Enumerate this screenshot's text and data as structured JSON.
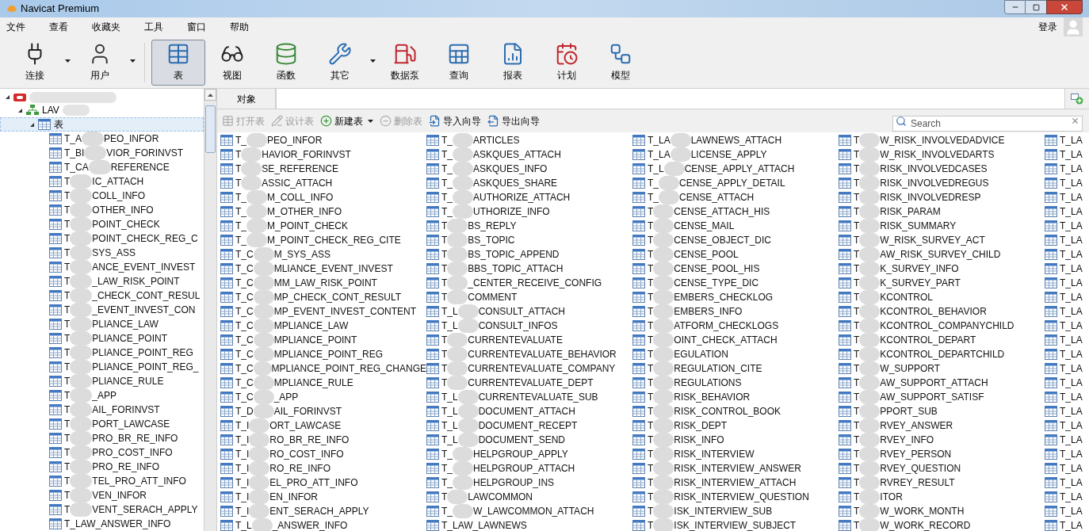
{
  "window": {
    "title": "Navicat Premium"
  },
  "menu": [
    "文件",
    "查看",
    "收藏夹",
    "工具",
    "窗口",
    "帮助"
  ],
  "login": "登录",
  "toolbar": [
    {
      "label": "连接",
      "selected": false,
      "dropdown": true
    },
    {
      "label": "用户",
      "selected": false,
      "dropdown": true
    },
    {
      "label": "表",
      "selected": true,
      "dropdown": false
    },
    {
      "label": "视图",
      "selected": false,
      "dropdown": false
    },
    {
      "label": "函数",
      "selected": false,
      "dropdown": false
    },
    {
      "label": "其它",
      "selected": false,
      "dropdown": true
    },
    {
      "label": "数据泵",
      "selected": false,
      "dropdown": false
    },
    {
      "label": "查询",
      "selected": false,
      "dropdown": false
    },
    {
      "label": "报表",
      "selected": false,
      "dropdown": false
    },
    {
      "label": "计划",
      "selected": false,
      "dropdown": false
    },
    {
      "label": "模型",
      "selected": false,
      "dropdown": false
    }
  ],
  "tree": {
    "connection": {
      "expanded": true
    },
    "database": {
      "label": "LAV",
      "expanded": true
    },
    "tables_node": {
      "label": "表",
      "expanded": true,
      "selected": true
    },
    "items": [
      [
        "T_A",
        "PEO_INFOR"
      ],
      [
        "T_BI",
        "VIOR_FORINVST"
      ],
      [
        "T_CA",
        "REFERENCE"
      ],
      [
        "T",
        "IC_ATTACH"
      ],
      [
        "T",
        "COLL_INFO"
      ],
      [
        "T",
        "OTHER_INFO"
      ],
      [
        "T",
        "POINT_CHECK"
      ],
      [
        "T",
        "POINT_CHECK_REG_C"
      ],
      [
        "T",
        "SYS_ASS"
      ],
      [
        "T",
        "ANCE_EVENT_INVEST"
      ],
      [
        "T",
        "_LAW_RISK_POINT"
      ],
      [
        "T",
        "_CHECK_CONT_RESUL"
      ],
      [
        "T",
        "_EVENT_INVEST_CON"
      ],
      [
        "T",
        "PLIANCE_LAW"
      ],
      [
        "T",
        "PLIANCE_POINT"
      ],
      [
        "T",
        "PLIANCE_POINT_REG"
      ],
      [
        "T",
        "PLIANCE_POINT_REG_"
      ],
      [
        "T",
        "PLIANCE_RULE"
      ],
      [
        "T",
        "_APP"
      ],
      [
        "T",
        "AIL_FORINVST"
      ],
      [
        "T",
        "PORT_LAWCASE"
      ],
      [
        "T",
        "PRO_BR_RE_INFO"
      ],
      [
        "T",
        "PRO_COST_INFO"
      ],
      [
        "T",
        "PRO_RE_INFO"
      ],
      [
        "T",
        "TEL_PRO_ATT_INFO"
      ],
      [
        "T",
        "VEN_INFOR"
      ],
      [
        "T",
        "VENT_SERACH_APPLY"
      ],
      [
        "T_LAW_ANSWER_INFO"
      ]
    ]
  },
  "object_tab": {
    "label": "对象",
    "selected": true
  },
  "actions": [
    {
      "label": "打开表",
      "disabled": true,
      "dropdown": false
    },
    {
      "label": "设计表",
      "disabled": true,
      "dropdown": false
    },
    {
      "label": "新建表",
      "disabled": false,
      "dropdown": true
    },
    {
      "label": "删除表",
      "disabled": true,
      "dropdown": false
    },
    {
      "label": "导入向导",
      "disabled": false,
      "dropdown": false
    },
    {
      "label": "导出向导",
      "disabled": false,
      "dropdown": false
    }
  ],
  "search": {
    "placeholder": "Search"
  },
  "columns": [
    [
      [
        "T_",
        "PEO_INFOR"
      ],
      [
        "T",
        "HAVIOR_FORINVST"
      ],
      [
        "T",
        "SE_REFERENCE"
      ],
      [
        "T",
        "ASSIC_ATTACH"
      ],
      [
        "T_",
        "M_COLL_INFO"
      ],
      [
        "T_",
        "M_OTHER_INFO"
      ],
      [
        "T_",
        "M_POINT_CHECK"
      ],
      [
        "T_",
        "M_POINT_CHECK_REG_CITE"
      ],
      [
        "T_C",
        "M_SYS_ASS"
      ],
      [
        "T_C",
        "MLIANCE_EVENT_INVEST"
      ],
      [
        "T_C",
        "MM_LAW_RISK_POINT"
      ],
      [
        "T_C",
        "MP_CHECK_CONT_RESULT"
      ],
      [
        "T_C",
        "MP_EVENT_INVEST_CONTENT"
      ],
      [
        "T_C",
        "MPLIANCE_LAW"
      ],
      [
        "T_C",
        "MPLIANCE_POINT"
      ],
      [
        "T_C",
        "MPLIANCE_POINT_REG"
      ],
      [
        "T_C",
        "MPLIANCE_POINT_REG_CHANGE"
      ],
      [
        "T_C",
        "MPLIANCE_RULE"
      ],
      [
        "T_C",
        "_APP"
      ],
      [
        "T_D",
        "AIL_FORINVST"
      ],
      [
        "T_I",
        "ORT_LAWCASE"
      ],
      [
        "T_I",
        "RO_BR_RE_INFO"
      ],
      [
        "T_I",
        "RO_COST_INFO"
      ],
      [
        "T_I",
        "RO_RE_INFO"
      ],
      [
        "T_I",
        "EL_PRO_ATT_INFO"
      ],
      [
        "T_I",
        "EN_INFOR"
      ],
      [
        "T_I",
        "ENT_SERACH_APPLY"
      ],
      [
        "T_L",
        "_ANSWER_INFO"
      ]
    ],
    [
      [
        "T_",
        "ARTICLES"
      ],
      [
        "T_",
        "ASKQUES_ATTACH"
      ],
      [
        "T_",
        "ASKQUES_INFO"
      ],
      [
        "T_",
        "ASKQUES_SHARE"
      ],
      [
        "T_",
        "AUTHORIZE_ATTACH"
      ],
      [
        "T_",
        "UTHORIZE_INFO"
      ],
      [
        "T",
        "BS_REPLY"
      ],
      [
        "T",
        "BS_TOPIC"
      ],
      [
        "T",
        "BS_TOPIC_APPEND"
      ],
      [
        "T",
        "BBS_TOPIC_ATTACH"
      ],
      [
        "T",
        "_CENTER_RECEIVE_CONFIG"
      ],
      [
        "T",
        "COMMENT"
      ],
      [
        "T_L",
        "CONSULT_ATTACH"
      ],
      [
        "T_L",
        "CONSULT_INFOS"
      ],
      [
        "T",
        "CURRENTEVALUATE"
      ],
      [
        "T",
        "CURRENTEVALUATE_BEHAVIOR"
      ],
      [
        "T",
        "CURRENTEVALUATE_COMPANY"
      ],
      [
        "T",
        "CURRENTEVALUATE_DEPT"
      ],
      [
        "T_L",
        "CURRENTEVALUATE_SUB"
      ],
      [
        "T_L",
        "DOCUMENT_ATTACH"
      ],
      [
        "T_L",
        "DOCUMENT_RECEPT"
      ],
      [
        "T_L",
        "DOCUMENT_SEND"
      ],
      [
        "T_",
        "HELPGROUP_APPLY"
      ],
      [
        "T_",
        "HELPGROUP_ATTACH"
      ],
      [
        "T_",
        "HELPGROUP_INS"
      ],
      [
        "T",
        "LAWCOMMON"
      ],
      [
        "T_",
        "W_LAWCOMMON_ATTACH"
      ],
      [
        "T_LAW_LAWNEWS"
      ]
    ],
    [
      [
        "T_LA",
        "LAWNEWS_ATTACH"
      ],
      [
        "T_LA",
        "LICENSE_APPLY"
      ],
      [
        "T_L",
        "CENSE_APPLY_ATTACH"
      ],
      [
        "T_",
        "CENSE_APPLY_DETAIL"
      ],
      [
        "T_",
        "CENSE_ATTACH"
      ],
      [
        "T",
        "CENSE_ATTACH_HIS"
      ],
      [
        "T",
        "CENSE_MAIL"
      ],
      [
        "T",
        "CENSE_OBJECT_DIC"
      ],
      [
        "T",
        "CENSE_POOL"
      ],
      [
        "T",
        "CENSE_POOL_HIS"
      ],
      [
        "T",
        "CENSE_TYPE_DIC"
      ],
      [
        "T",
        "EMBERS_CHECKLOG"
      ],
      [
        "T",
        "EMBERS_INFO"
      ],
      [
        "T",
        "ATFORM_CHECKLOGS"
      ],
      [
        "T",
        "OINT_CHECK_ATTACH"
      ],
      [
        "T",
        "EGULATION"
      ],
      [
        "T",
        "REGULATION_CITE"
      ],
      [
        "T",
        "REGULATIONS"
      ],
      [
        "T",
        "RISK_BEHAVIOR"
      ],
      [
        "T",
        "RISK_CONTROL_BOOK"
      ],
      [
        "T",
        "RISK_DEPT"
      ],
      [
        "T",
        "RISK_INFO"
      ],
      [
        "T",
        "RISK_INTERVIEW"
      ],
      [
        "T",
        "RISK_INTERVIEW_ANSWER"
      ],
      [
        "T",
        "RISK_INTERVIEW_ATTACH"
      ],
      [
        "T",
        "RISK_INTERVIEW_QUESTION"
      ],
      [
        "T",
        "ISK_INTERVIEW_SUB"
      ],
      [
        "T",
        "ISK_INTERVIEW_SUBJECT"
      ]
    ],
    [
      [
        "T",
        "W_RISK_INVOLVEDADVICE"
      ],
      [
        "T",
        "W_RISK_INVOLVEDARTS"
      ],
      [
        "T",
        "RISK_INVOLVEDCASES"
      ],
      [
        "T",
        "RISK_INVOLVEDREGUS"
      ],
      [
        "T",
        "RISK_INVOLVEDRESP"
      ],
      [
        "T",
        "RISK_PARAM"
      ],
      [
        "T",
        "RISK_SUMMARY"
      ],
      [
        "T",
        "W_RISK_SURVEY_ACT"
      ],
      [
        "T",
        "AW_RISK_SURVEY_CHILD"
      ],
      [
        "T",
        "K_SURVEY_INFO"
      ],
      [
        "T",
        "K_SURVEY_PART"
      ],
      [
        "T",
        "KCONTROL"
      ],
      [
        "T",
        "KCONTROL_BEHAVIOR"
      ],
      [
        "T",
        "KCONTROL_COMPANYCHILD"
      ],
      [
        "T",
        "KCONTROL_DEPART"
      ],
      [
        "T",
        "KCONTROL_DEPARTCHILD"
      ],
      [
        "T",
        "W_SUPPORT"
      ],
      [
        "T",
        "AW_SUPPORT_ATTACH"
      ],
      [
        "T",
        "AW_SUPPORT_SATISF"
      ],
      [
        "T",
        "PPORT_SUB"
      ],
      [
        "T",
        "RVEY_ANSWER"
      ],
      [
        "T",
        "RVEY_INFO"
      ],
      [
        "T",
        "RVEY_PERSON"
      ],
      [
        "T",
        "RVEY_QUESTION"
      ],
      [
        "T",
        "RVREY_RESULT"
      ],
      [
        "T",
        "ITOR"
      ],
      [
        "T",
        "W_WORK_MONTH"
      ],
      [
        "T",
        "W_WORK_RECORD"
      ]
    ],
    [
      [
        "T_LA"
      ],
      [
        "T_LA"
      ],
      [
        "T_LA"
      ],
      [
        "T_LA"
      ],
      [
        "T_LA"
      ],
      [
        "T_LA"
      ],
      [
        "T_LA"
      ],
      [
        "T_LA"
      ],
      [
        "T_LA"
      ],
      [
        "T_LA"
      ],
      [
        "T_LA"
      ],
      [
        "T_LA"
      ],
      [
        "T_LA"
      ],
      [
        "T_LA"
      ],
      [
        "T_LA"
      ],
      [
        "T_LA"
      ],
      [
        "T_LA"
      ],
      [
        "T_LA"
      ],
      [
        "T_LA"
      ],
      [
        "T_LA"
      ],
      [
        "T_LA"
      ],
      [
        "T_LA"
      ],
      [
        "T_LA"
      ],
      [
        "T_LA"
      ],
      [
        "T_LA"
      ],
      [
        "T_LA"
      ],
      [
        "T_LA"
      ],
      [
        "T_LA"
      ]
    ]
  ]
}
